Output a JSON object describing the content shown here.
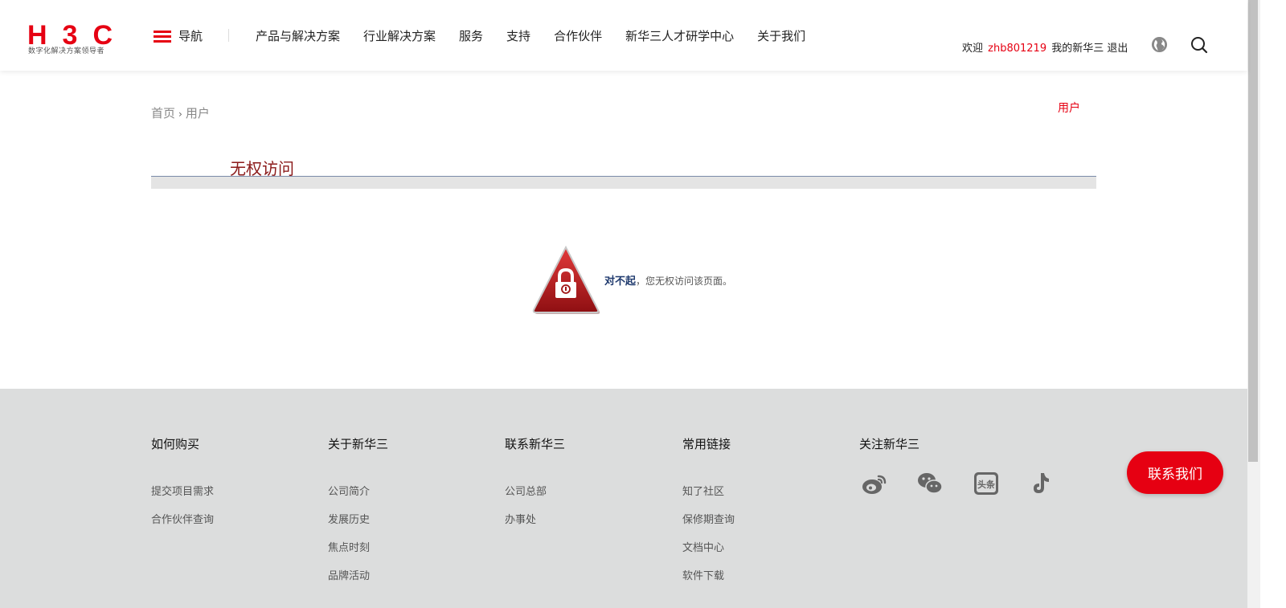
{
  "header": {
    "logo_text": "H3C",
    "logo_tagline": "数字化解决方案领导者",
    "nav_toggle_label": "导航",
    "nav_items": [
      "产品与解决方案",
      "行业解决方案",
      "服务",
      "支持",
      "合作伙伴",
      "新华三人才研学中心",
      "关于我们"
    ],
    "welcome": "欢迎",
    "username": "zhb801219",
    "my_account": "我的新华三",
    "logout": "退出"
  },
  "breadcrumb": {
    "home": "首页",
    "separator": "›",
    "current": "用户"
  },
  "side_link": "用户",
  "page_title": "无权访问",
  "message": {
    "strong": "对不起",
    "rest": "，您无权访问该页面。"
  },
  "footer": {
    "columns": [
      {
        "title": "如何购买",
        "links": [
          "提交项目需求",
          "合作伙伴查询"
        ]
      },
      {
        "title": "关于新华三",
        "links": [
          "公司简介",
          "发展历史",
          "焦点时刻",
          "品牌活动"
        ]
      },
      {
        "title": "联系新华三",
        "links": [
          "公司总部",
          "办事处"
        ]
      },
      {
        "title": "常用链接",
        "links": [
          "知了社区",
          "保修期查询",
          "文档中心",
          "软件下载"
        ]
      },
      {
        "title": "关注新华三",
        "links": []
      }
    ],
    "social_icons": [
      "weibo-icon",
      "wechat-icon",
      "toutiao-icon",
      "tiktok-icon"
    ],
    "toutiao_text": "头条"
  },
  "contact_button": "联系我们",
  "colors": {
    "brand_red": "#e60012",
    "title_red": "#8b1a1a",
    "footer_bg": "#dcdddd"
  }
}
